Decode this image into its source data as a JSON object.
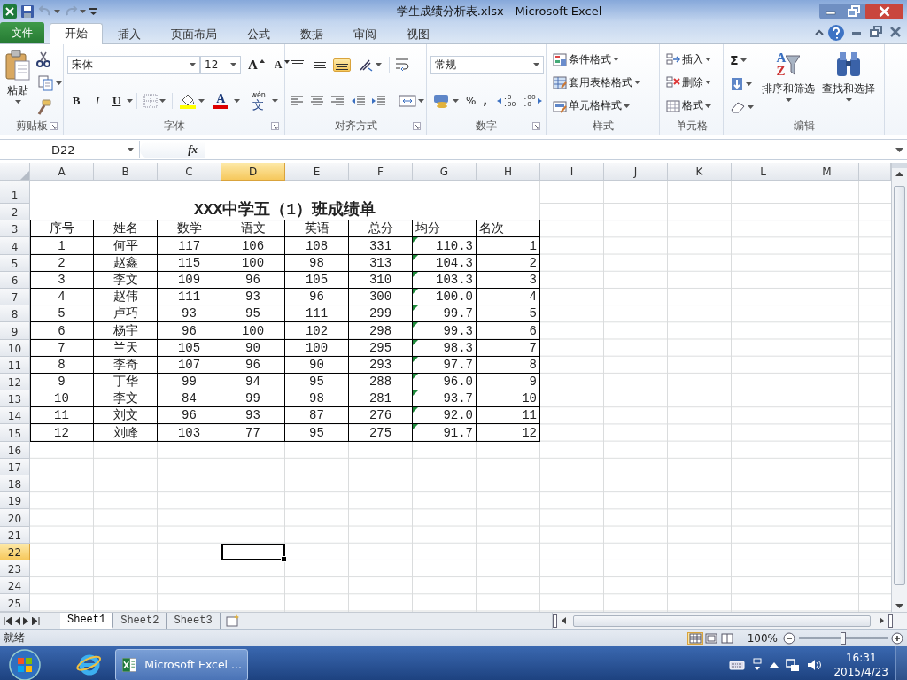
{
  "window": {
    "title": "学生成绩分析表.xlsx - Microsoft Excel"
  },
  "ribbon_tabs": [
    {
      "label": "文件",
      "kind": "file",
      "selected": false
    },
    {
      "label": "开始",
      "kind": "tab",
      "selected": true
    },
    {
      "label": "插入",
      "kind": "tab",
      "selected": false
    },
    {
      "label": "页面布局",
      "kind": "tab",
      "selected": false
    },
    {
      "label": "公式",
      "kind": "tab",
      "selected": false
    },
    {
      "label": "数据",
      "kind": "tab",
      "selected": false
    },
    {
      "label": "审阅",
      "kind": "tab",
      "selected": false
    },
    {
      "label": "视图",
      "kind": "tab",
      "selected": false
    }
  ],
  "ribbon_groups": [
    {
      "kind": "clipboard",
      "label": "剪贴板",
      "launcher": true,
      "paste": "粘贴"
    },
    {
      "kind": "font",
      "label": "字体",
      "launcher": true,
      "font_name": "宋体",
      "font_size": "12",
      "grow": "A",
      "shrink": "A",
      "bold": "B",
      "italic": "I",
      "underline": "U",
      "font_color": "A",
      "phonetic": "wén",
      "phonetic_char": "文"
    },
    {
      "kind": "alignment",
      "label": "对齐方式",
      "launcher": true,
      "vertical": [
        {
          "selected": false
        },
        {
          "selected": false
        },
        {
          "selected": true
        }
      ]
    },
    {
      "kind": "number",
      "label": "数字",
      "launcher": true,
      "format": "常规",
      "percent": "%",
      "comma": ",",
      "increase_decimal": [
        ".0",
        ".00"
      ],
      "decrease_decimal": [
        ".00",
        ".0"
      ]
    },
    {
      "kind": "styles",
      "label": "样式",
      "launcher": false,
      "items": [
        "条件格式",
        "套用表格格式",
        "单元格样式"
      ]
    },
    {
      "kind": "cells",
      "label": "单元格",
      "launcher": false,
      "items": [
        "插入",
        "删除",
        "格式"
      ]
    },
    {
      "kind": "editing",
      "label": "编辑",
      "launcher": false,
      "sigma": "Σ",
      "sort_letters": [
        "A",
        "Z"
      ],
      "items": [
        "排序和筛选",
        "查找和选择"
      ]
    }
  ],
  "formula_bar": {
    "name_box": "D22",
    "fx": "fx"
  },
  "sheet": {
    "columns": [
      {
        "label": "A",
        "selected": false
      },
      {
        "label": "B",
        "selected": false
      },
      {
        "label": "C",
        "selected": false
      },
      {
        "label": "D",
        "selected": true
      },
      {
        "label": "E",
        "selected": false
      },
      {
        "label": "F",
        "selected": false
      },
      {
        "label": "G",
        "selected": false
      },
      {
        "label": "H",
        "selected": false
      },
      {
        "label": "I",
        "selected": false
      },
      {
        "label": "J",
        "selected": false
      },
      {
        "label": "K",
        "selected": false
      },
      {
        "label": "L",
        "selected": false
      },
      {
        "label": "M",
        "selected": false
      }
    ],
    "row_headers": [
      {
        "label": "1",
        "selected": false
      },
      {
        "label": "2",
        "selected": false
      },
      {
        "label": "3",
        "selected": false
      },
      {
        "label": "4",
        "selected": false
      },
      {
        "label": "5",
        "selected": false
      },
      {
        "label": "6",
        "selected": false
      },
      {
        "label": "7",
        "selected": false
      },
      {
        "label": "8",
        "selected": false
      },
      {
        "label": "9",
        "selected": false
      },
      {
        "label": "10",
        "selected": false
      },
      {
        "label": "11",
        "selected": false
      },
      {
        "label": "12",
        "selected": false
      },
      {
        "label": "13",
        "selected": false
      },
      {
        "label": "14",
        "selected": false
      },
      {
        "label": "15",
        "selected": false
      },
      {
        "label": "16",
        "selected": false
      },
      {
        "label": "17",
        "selected": false
      },
      {
        "label": "18",
        "selected": false
      },
      {
        "label": "19",
        "selected": false
      },
      {
        "label": "20",
        "selected": false
      },
      {
        "label": "21",
        "selected": false
      },
      {
        "label": "22",
        "selected": true
      },
      {
        "label": "23",
        "selected": false
      },
      {
        "label": "24",
        "selected": false
      },
      {
        "label": "25",
        "selected": false
      }
    ],
    "title": "XXX中学五（1）班成绩单",
    "header": [
      "序号",
      "姓名",
      "数学",
      "语文",
      "英语",
      "总分",
      "均分",
      "名次"
    ],
    "records": [
      {
        "cells": [
          "1",
          "何平",
          "117",
          "106",
          "108",
          "331",
          "110.3",
          "1"
        ],
        "average_flagged": true
      },
      {
        "cells": [
          "2",
          "赵鑫",
          "115",
          "100",
          "98",
          "313",
          "104.3",
          "2"
        ],
        "average_flagged": true
      },
      {
        "cells": [
          "3",
          "李文",
          "109",
          "96",
          "105",
          "310",
          "103.3",
          "3"
        ],
        "average_flagged": true
      },
      {
        "cells": [
          "4",
          "赵伟",
          "111",
          "93",
          "96",
          "300",
          "100.0",
          "4"
        ],
        "average_flagged": true
      },
      {
        "cells": [
          "5",
          "卢巧",
          "93",
          "95",
          "111",
          "299",
          "99.7",
          "5"
        ],
        "average_flagged": true
      },
      {
        "cells": [
          "6",
          "杨宇",
          "96",
          "100",
          "102",
          "298",
          "99.3",
          "6"
        ],
        "average_flagged": true
      },
      {
        "cells": [
          "7",
          "兰天",
          "105",
          "90",
          "100",
          "295",
          "98.3",
          "7"
        ],
        "average_flagged": true
      },
      {
        "cells": [
          "8",
          "李奇",
          "107",
          "96",
          "90",
          "293",
          "97.7",
          "8"
        ],
        "average_flagged": true
      },
      {
        "cells": [
          "9",
          "丁华",
          "99",
          "94",
          "95",
          "288",
          "96.0",
          "9"
        ],
        "average_flagged": true
      },
      {
        "cells": [
          "10",
          "李文",
          "84",
          "99",
          "98",
          "281",
          "93.7",
          "10"
        ],
        "average_flagged": true
      },
      {
        "cells": [
          "11",
          "刘文",
          "96",
          "93",
          "87",
          "276",
          "92.0",
          "11"
        ],
        "average_flagged": true
      },
      {
        "cells": [
          "12",
          "刘峰",
          "103",
          "77",
          "95",
          "275",
          "91.7",
          "12"
        ],
        "average_flagged": true
      }
    ]
  },
  "sheet_tabs": [
    {
      "label": "Sheet1",
      "selected": true
    },
    {
      "label": "Sheet2",
      "selected": false
    },
    {
      "label": "Sheet3",
      "selected": false
    }
  ],
  "status_bar": {
    "status": "就绪",
    "views": [
      {
        "selected": true
      },
      {
        "selected": false
      },
      {
        "selected": false
      }
    ],
    "zoom": {
      "reading": "100%",
      "level": 0.5
    }
  },
  "taskbar": {
    "app": "Microsoft Excel ...",
    "time": "16:31",
    "date": "2015/4/23"
  }
}
